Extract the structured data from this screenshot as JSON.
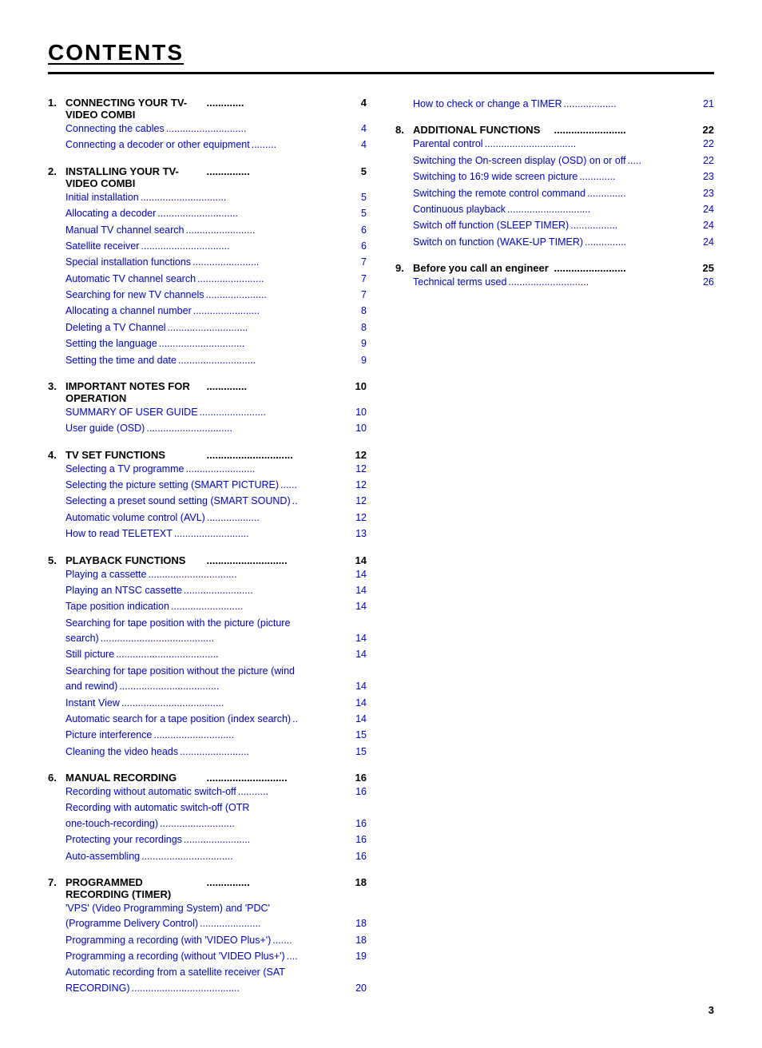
{
  "title": "CONTENTS",
  "page_number": "3",
  "left_column": [
    {
      "num": "1.",
      "title": "CONNECTING YOUR TV-VIDEO COMBI",
      "dots": ".............",
      "page": "4",
      "entries": [
        {
          "label": "Connecting the cables",
          "dots": ".............................",
          "page": "4"
        },
        {
          "label": "Connecting a decoder or other equipment",
          "dots": ".........",
          "page": "4"
        }
      ]
    },
    {
      "num": "2.",
      "title": "INSTALLING YOUR TV-VIDEO COMBI",
      "dots": "...............",
      "page": "5",
      "entries": [
        {
          "label": "Initial installation",
          "dots": "...............................",
          "page": "5"
        },
        {
          "label": "Allocating a decoder",
          "dots": ".............................",
          "page": "5"
        },
        {
          "label": "Manual TV channel search",
          "dots": ".........................",
          "page": "6"
        },
        {
          "label": "Satellite receiver",
          "dots": "................................",
          "page": "6"
        },
        {
          "label": "Special installation functions",
          "dots": "........................",
          "page": "7"
        },
        {
          "label": "Automatic TV channel search",
          "dots": "........................",
          "page": "7"
        },
        {
          "label": "Searching for new TV channels",
          "dots": "......................",
          "page": "7"
        },
        {
          "label": "Allocating a channel number",
          "dots": "........................",
          "page": "8"
        },
        {
          "label": "Deleting a TV Channel",
          "dots": ".............................",
          "page": "8"
        },
        {
          "label": "Setting the language",
          "dots": "...............................",
          "page": "9"
        },
        {
          "label": "Setting the time and date",
          "dots": "............................",
          "page": "9"
        }
      ]
    },
    {
      "num": "3.",
      "title": "IMPORTANT NOTES FOR OPERATION",
      "dots": "..............",
      "page": "10",
      "entries": [
        {
          "label": "SUMMARY OF USER GUIDE",
          "dots": "........................",
          "page": "10"
        },
        {
          "label": "User guide (OSD)",
          "dots": "...............................",
          "page": "10"
        }
      ]
    },
    {
      "num": "4.",
      "title": "TV SET FUNCTIONS",
      "dots": "..............................",
      "page": "12",
      "entries": [
        {
          "label": "Selecting a TV programme",
          "dots": ".........................",
          "page": "12"
        },
        {
          "label": "Selecting the picture setting (SMART PICTURE)",
          "dots": "......",
          "page": "12"
        },
        {
          "label": "Selecting a preset sound setting (SMART SOUND)",
          "dots": "..",
          "page": "12"
        },
        {
          "label": "Automatic volume control (AVL)",
          "dots": "...................",
          "page": "12"
        },
        {
          "label": "How to read TELETEXT",
          "dots": "...........................",
          "page": "13"
        }
      ]
    },
    {
      "num": "5.",
      "title": "PLAYBACK FUNCTIONS",
      "dots": "............................",
      "page": "14",
      "entries": [
        {
          "label": "Playing a cassette",
          "dots": "................................",
          "page": "14"
        },
        {
          "label": "Playing an NTSC cassette",
          "dots": ".........................",
          "page": "14"
        },
        {
          "label": "Tape position indication",
          "dots": "..........................",
          "page": "14"
        },
        {
          "label": "Searching for tape position with the picture (picture",
          "dots": "",
          "page": ""
        },
        {
          "label": "search)",
          "dots": ".........................................",
          "page": "14"
        },
        {
          "label": "Still picture",
          "dots": ".....................................",
          "page": "14"
        },
        {
          "label": "Searching for tape position without the picture (wind",
          "dots": "",
          "page": ""
        },
        {
          "label": "and rewind)",
          "dots": "....................................",
          "page": "14"
        },
        {
          "label": "Instant View",
          "dots": ".....................................",
          "page": "14"
        },
        {
          "label": "Automatic search for a tape position (index search)",
          "dots": "..",
          "page": "14"
        },
        {
          "label": "Picture interference",
          "dots": ".............................",
          "page": "15"
        },
        {
          "label": "Cleaning the video heads",
          "dots": ".........................",
          "page": "15"
        }
      ]
    },
    {
      "num": "6.",
      "title": "MANUAL RECORDING",
      "dots": "............................",
      "page": "16",
      "entries": [
        {
          "label": "Recording without automatic switch-off",
          "dots": "...........",
          "page": "16"
        },
        {
          "label": "Recording with automatic switch-off (OTR",
          "dots": "",
          "page": ""
        },
        {
          "label": "one-touch-recording)",
          "dots": "...........................",
          "page": "16"
        },
        {
          "label": "Protecting your recordings",
          "dots": "........................",
          "page": "16"
        },
        {
          "label": "Auto-assembling",
          "dots": ".................................",
          "page": "16"
        }
      ]
    },
    {
      "num": "7.",
      "title": "PROGRAMMED RECORDING (TIMER)",
      "dots": "...............",
      "page": "18",
      "entries": [
        {
          "label": "'VPS' (Video Programming System) and 'PDC'",
          "dots": "",
          "page": ""
        },
        {
          "label": "(Programme Delivery Control)",
          "dots": "......................",
          "page": "18"
        },
        {
          "label": "Programming a recording (with 'VIDEO Plus+')",
          "dots": ".......",
          "page": "18"
        },
        {
          "label": "Programming a recording (without 'VIDEO Plus+')",
          "dots": "....",
          "page": "19"
        },
        {
          "label": "Automatic recording from a satellite receiver (SAT",
          "dots": "",
          "page": ""
        },
        {
          "label": "RECORDING)",
          "dots": ".......................................",
          "page": "20"
        }
      ]
    }
  ],
  "right_column": [
    {
      "num": "",
      "title": "",
      "entries": [
        {
          "label": "How to check or change a TIMER",
          "dots": "...................",
          "page": "21",
          "black": false
        }
      ]
    },
    {
      "num": "8.",
      "title": "ADDITIONAL FUNCTIONS",
      "dots": ".........................",
      "page": "22",
      "entries": [
        {
          "label": "Parental control",
          "dots": ".................................",
          "page": "22"
        },
        {
          "label": "Switching the On-screen display (OSD) on or off",
          "dots": ".....",
          "page": "22"
        },
        {
          "label": "Switching to 16:9 wide screen picture",
          "dots": ".............",
          "page": "23"
        },
        {
          "label": "Switching the remote control command",
          "dots": "..............",
          "page": "23"
        },
        {
          "label": "Continuous playback",
          "dots": "..............................",
          "page": "24"
        },
        {
          "label": "Switch off function (SLEEP TIMER)",
          "dots": ".................",
          "page": "24"
        },
        {
          "label": "Switch on function (WAKE-UP TIMER)",
          "dots": "...............",
          "page": "24"
        }
      ]
    },
    {
      "num": "9.",
      "title": "Before you call an engineer",
      "dots": ".........................",
      "page": "25",
      "entries": [
        {
          "label": "Technical terms used",
          "dots": ".............................",
          "page": "26"
        }
      ]
    }
  ]
}
